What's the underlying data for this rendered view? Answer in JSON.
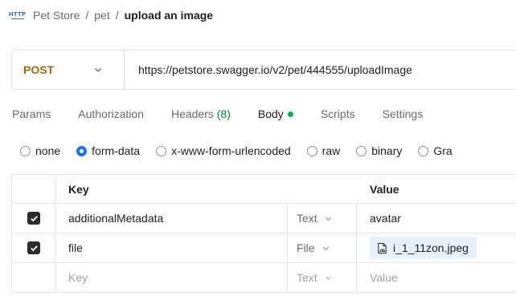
{
  "breadcrumb": {
    "icon": "http-icon",
    "icon_text": "HTTP",
    "items": [
      "Pet Store",
      "pet"
    ],
    "separator": "/",
    "current": "upload an image"
  },
  "request": {
    "method": "POST",
    "url": "https://petstore.swagger.io/v2/pet/444555/uploadImage"
  },
  "tabs": [
    {
      "label": "Params"
    },
    {
      "label": "Authorization"
    },
    {
      "label": "Headers",
      "count": "(8)"
    },
    {
      "label": "Body",
      "active": true,
      "indicator": "green-dot"
    },
    {
      "label": "Scripts"
    },
    {
      "label": "Settings"
    }
  ],
  "body_types": [
    {
      "label": "none",
      "selected": false
    },
    {
      "label": "form-data",
      "selected": true
    },
    {
      "label": "x-www-form-urlencoded",
      "selected": false
    },
    {
      "label": "raw",
      "selected": false
    },
    {
      "label": "binary",
      "selected": false
    },
    {
      "label": "Gra",
      "selected": false
    }
  ],
  "table": {
    "headers": {
      "key": "Key",
      "value": "Value"
    },
    "rows": [
      {
        "checked": true,
        "key": "additionalMetadata",
        "type": "Text",
        "value": "avatar"
      },
      {
        "checked": true,
        "key": "file",
        "type": "File",
        "value": "i_1_11zon.jpeg",
        "value_icon": "file-image-icon"
      }
    ],
    "empty_row": {
      "key_placeholder": "Key",
      "type": "Text",
      "value_placeholder": "Value"
    }
  },
  "colors": {
    "method": "#a36a0e",
    "accent": "#1a73e8",
    "active_dot": "#0ca84c",
    "headers_count": "#0a8a3a"
  }
}
